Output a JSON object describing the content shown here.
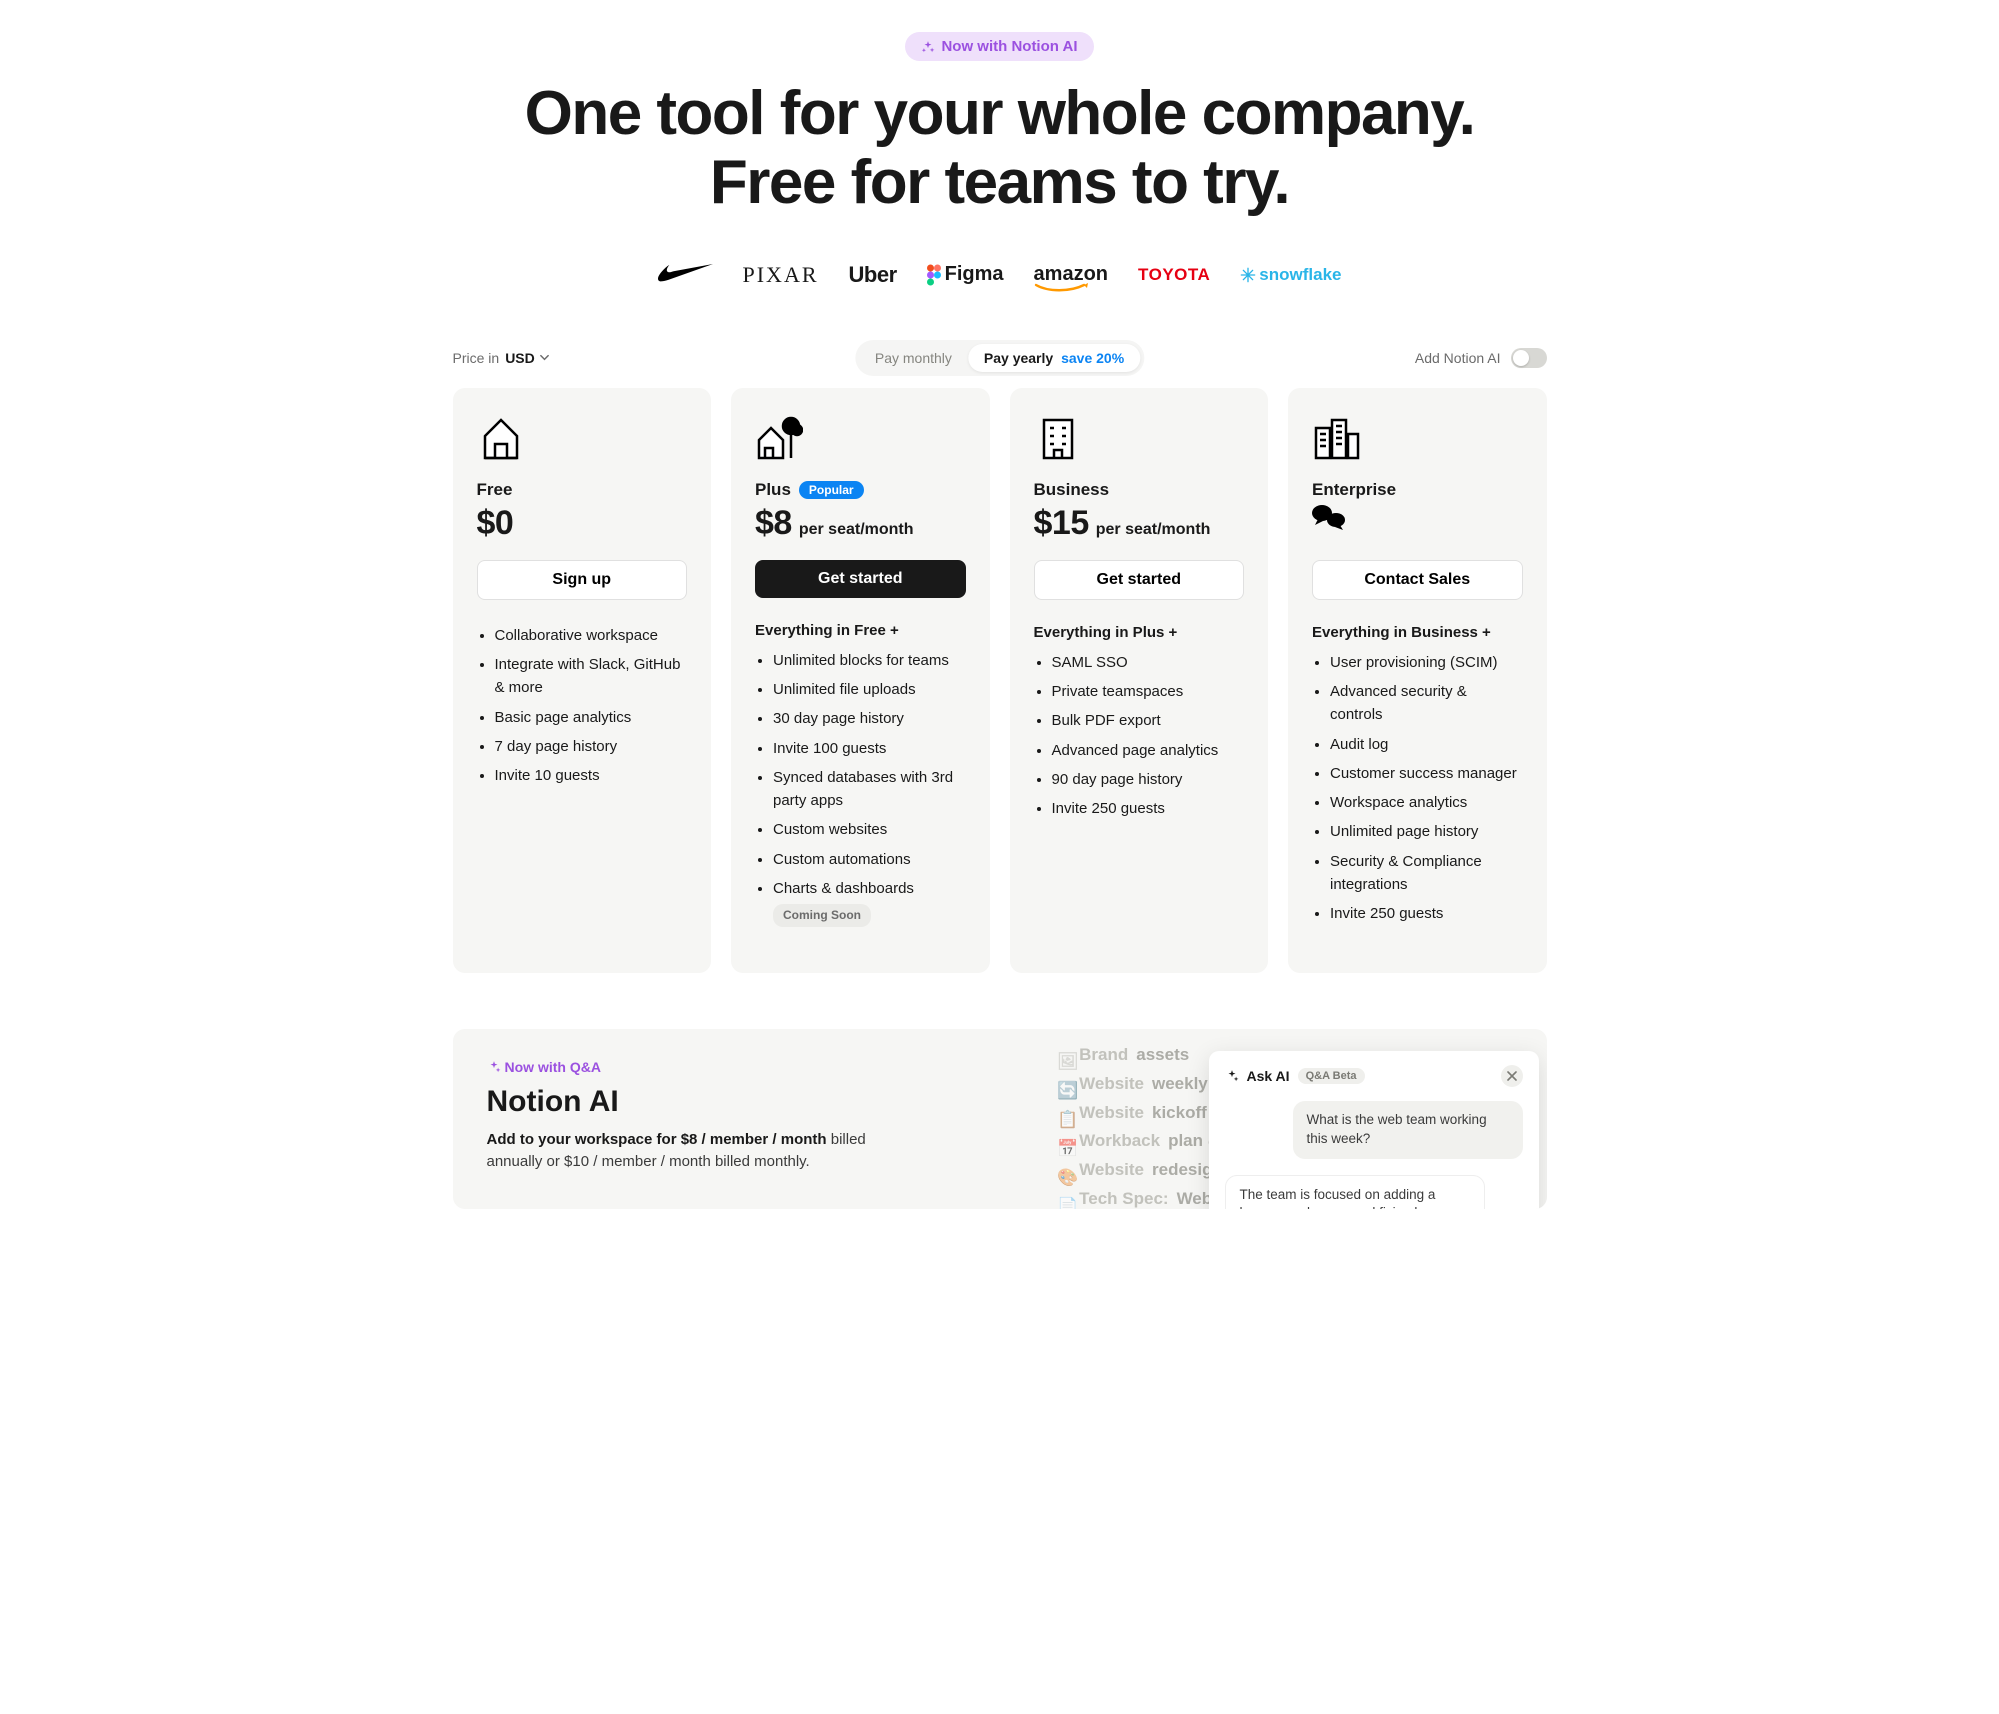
{
  "hero": {
    "ai_badge": "Now with Notion AI",
    "heading_line1": "One tool for your whole company.",
    "heading_line2": "Free for teams to try.",
    "logos": [
      "Nike",
      "PIXAR",
      "Uber",
      "Figma",
      "amazon",
      "TOYOTA",
      "snowflake"
    ]
  },
  "controls": {
    "price_in_label": "Price in",
    "currency": "USD",
    "pay_monthly": "Pay monthly",
    "pay_yearly": "Pay yearly",
    "save_pct": "save 20%",
    "add_ai_label": "Add Notion AI"
  },
  "plans": {
    "free": {
      "name": "Free",
      "price": "$0",
      "unit": "",
      "cta": "Sign up",
      "includes_header": "",
      "features": [
        "Collaborative workspace",
        "Integrate with Slack, GitHub & more",
        "Basic page analytics",
        "7 day page history",
        "Invite 10 guests"
      ]
    },
    "plus": {
      "name": "Plus",
      "badge": "Popular",
      "price": "$8",
      "unit": "per seat/month",
      "cta": "Get started",
      "includes_header": "Everything in Free +",
      "features": [
        "Unlimited blocks for teams",
        "Unlimited file uploads",
        "30 day page history",
        "Invite 100 guests",
        "Synced databases with 3rd party apps",
        "Custom websites",
        "Custom automations",
        "Charts & dashboards"
      ],
      "coming_soon": "Coming Soon"
    },
    "business": {
      "name": "Business",
      "price": "$15",
      "unit": "per seat/month",
      "cta": "Get started",
      "includes_header": "Everything in Plus +",
      "features": [
        "SAML SSO",
        "Private teamspaces",
        "Bulk PDF export",
        "Advanced page analytics",
        "90 day page history",
        "Invite 250 guests"
      ]
    },
    "enterprise": {
      "name": "Enterprise",
      "cta": "Contact Sales",
      "includes_header": "Everything in Business +",
      "features": [
        "User provisioning (SCIM)",
        "Advanced security & controls",
        "Audit log",
        "Customer success manager",
        "Workspace analytics",
        "Unlimited page history",
        "Security & Compliance integrations",
        "Invite 250 guests"
      ]
    }
  },
  "ai_section": {
    "pill": "Now with Q&A",
    "title": "Notion AI",
    "body_bold": "Add to your workspace for $8 / member / month",
    "body_rest": " billed annually or $10 / member / month billed monthly.",
    "ghost_items": [
      {
        "pre": "Brand ",
        "bold": "assets"
      },
      {
        "pre": "Website ",
        "bold": "weekly sy"
      },
      {
        "pre": "Website ",
        "bold": "kickoff m"
      },
      {
        "pre": "Workback ",
        "bold": "plan @"
      },
      {
        "pre": "Website ",
        "bold": "redesign"
      },
      {
        "pre": "Tech Spec: ",
        "bold": "Websi"
      }
    ],
    "chat": {
      "title": "Ask AI",
      "beta": "Q&A Beta",
      "user_msg": "What is the web team working this week?",
      "assistant_msg": "The team is focused on adding a homepage banner and fixing bugs."
    }
  }
}
